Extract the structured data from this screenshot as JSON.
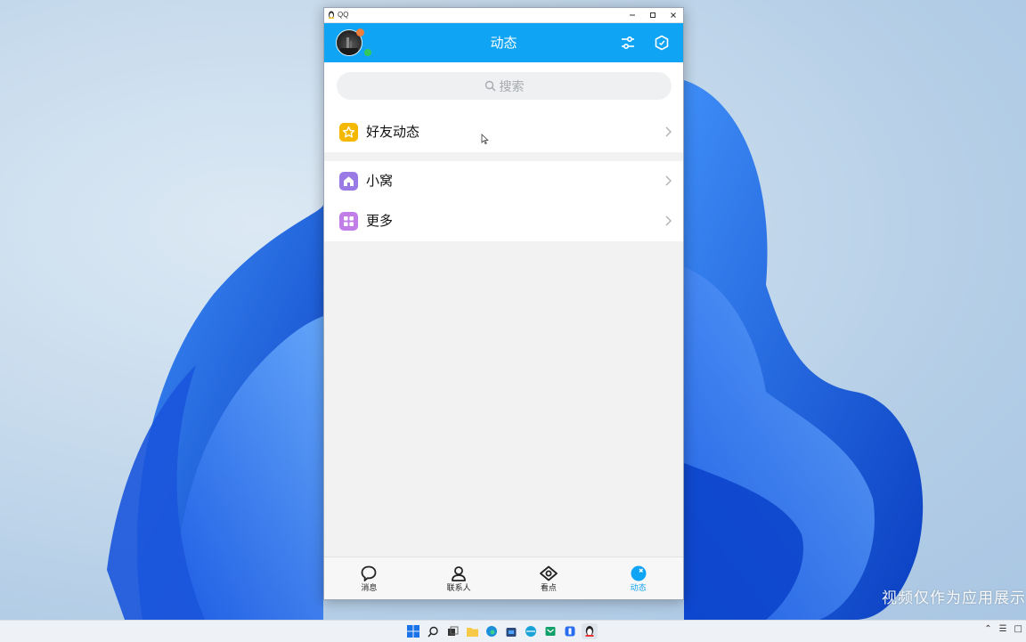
{
  "window": {
    "title": "QQ",
    "controls": [
      "minimize-icon",
      "maximize-icon",
      "close-icon"
    ]
  },
  "header": {
    "title": "动态",
    "buttons": [
      "settings-sliders-icon",
      "shield-icon"
    ],
    "accent_color": "#10a5f4"
  },
  "search": {
    "placeholder": "搜索",
    "icon": "search-icon"
  },
  "menu": {
    "friends_feed": {
      "label": "好友动态",
      "icon": "star-icon",
      "color": "#f5b800"
    },
    "nest": {
      "label": "小窝",
      "icon": "house-icon",
      "color": "#9a7be6"
    },
    "more": {
      "label": "更多",
      "icon": "grid-icon",
      "color": "#c17ee8"
    }
  },
  "bottom_nav": [
    {
      "label": "消息",
      "icon": "chat-bubble-icon",
      "active": false
    },
    {
      "label": "联系人",
      "icon": "person-icon",
      "active": false
    },
    {
      "label": "看点",
      "icon": "eye-icon",
      "active": false
    },
    {
      "label": "动态",
      "icon": "feed-icon",
      "active": true
    }
  ],
  "watermark": "视频仅作为应用展示"
}
